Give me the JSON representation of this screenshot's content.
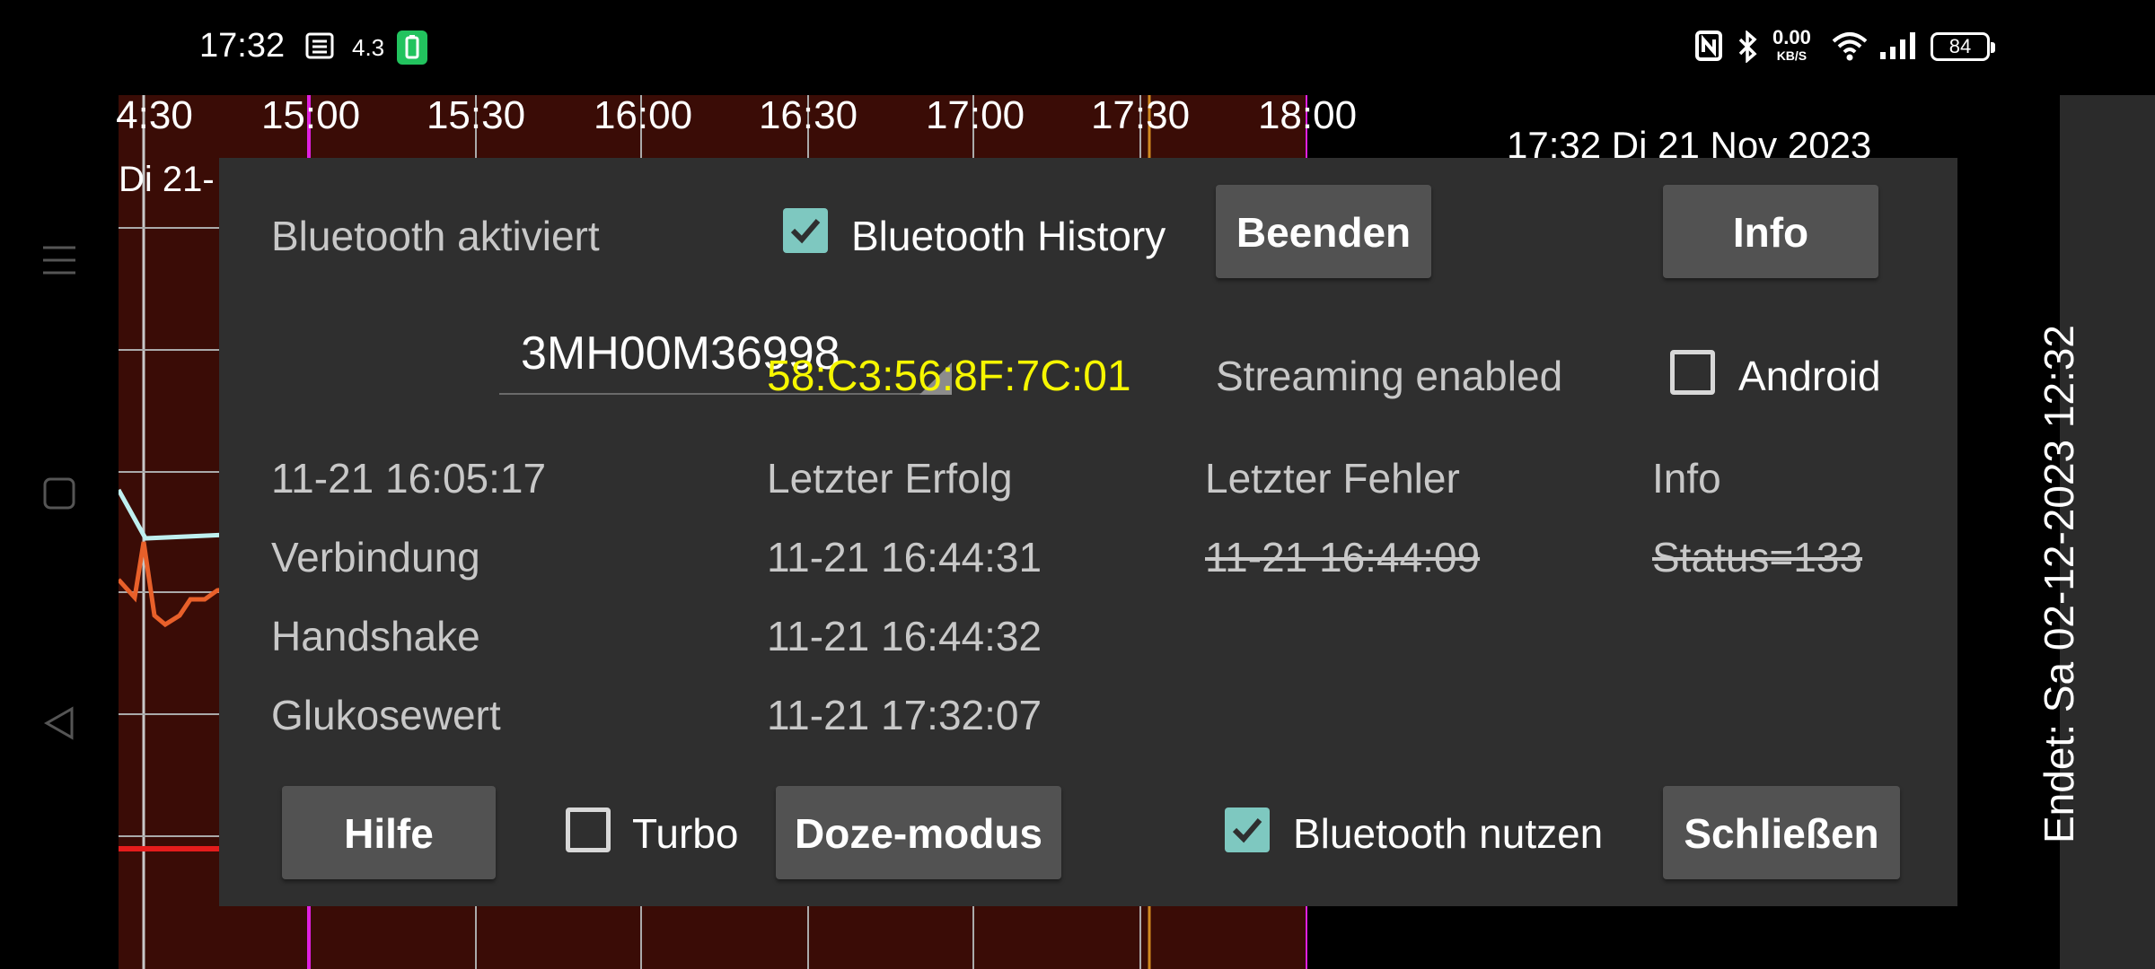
{
  "status_bar": {
    "time": "17:32",
    "small_indicator": "4.3",
    "network_speed": "0.00",
    "network_unit": "KB/S",
    "battery_level": "84",
    "icons": [
      "notification-list-icon",
      "battery-saver-icon",
      "nfc-icon",
      "bluetooth-icon",
      "wifi-icon",
      "signal-icon",
      "battery-icon"
    ]
  },
  "graph": {
    "time_labels": [
      "4:30",
      "15:00",
      "15:30",
      "16:00",
      "16:30",
      "17:00",
      "17:30",
      "18:00"
    ],
    "date_label": "Di 21-",
    "current_datetime": "17:32 Di 21 Nov 2023",
    "sensor_end": "Endet: Sa 02-12-2023 12:32",
    "colors": {
      "background": "#3a0c06",
      "glucose_line": "#e8602a",
      "trend_line": "#bff0f0",
      "low_limit": "#e51c1c",
      "now_marker": "#e020e0"
    }
  },
  "nav": {
    "icons": [
      "menu-icon",
      "home-square-icon",
      "back-triangle-icon"
    ]
  },
  "dialog": {
    "bluetooth_status": "Bluetooth aktiviert",
    "bluetooth_history_label": "Bluetooth History",
    "bluetooth_history_checked": true,
    "stop_button": "Beenden",
    "info_button": "Info",
    "sensor_selected": "3MH00M36998",
    "mac_address": "58:C3:56:8F:7C:01",
    "streaming_status": "Streaming enabled",
    "android_label": "Android",
    "android_checked": false,
    "table": {
      "headers": [
        "11-21 16:05:17",
        "Letzter Erfolg",
        "Letzter Fehler",
        "Info"
      ],
      "rows": [
        {
          "label": "Verbindung",
          "success": "11-21 16:44:31",
          "error": "11-21 16:44:09",
          "info": "Status=133"
        },
        {
          "label": "Handshake",
          "success": "11-21 16:44:32",
          "error": "",
          "info": ""
        },
        {
          "label": "Glukosewert",
          "success": "11-21 17:32:07",
          "error": "",
          "info": ""
        }
      ]
    },
    "help_button": "Hilfe",
    "turbo_label": "Turbo",
    "turbo_checked": false,
    "doze_button": "Doze-modus",
    "use_bluetooth_label": "Bluetooth nutzen",
    "use_bluetooth_checked": true,
    "close_button": "Schließen",
    "accent_color": "#7ec8c0",
    "mac_color": "#f6f600"
  }
}
